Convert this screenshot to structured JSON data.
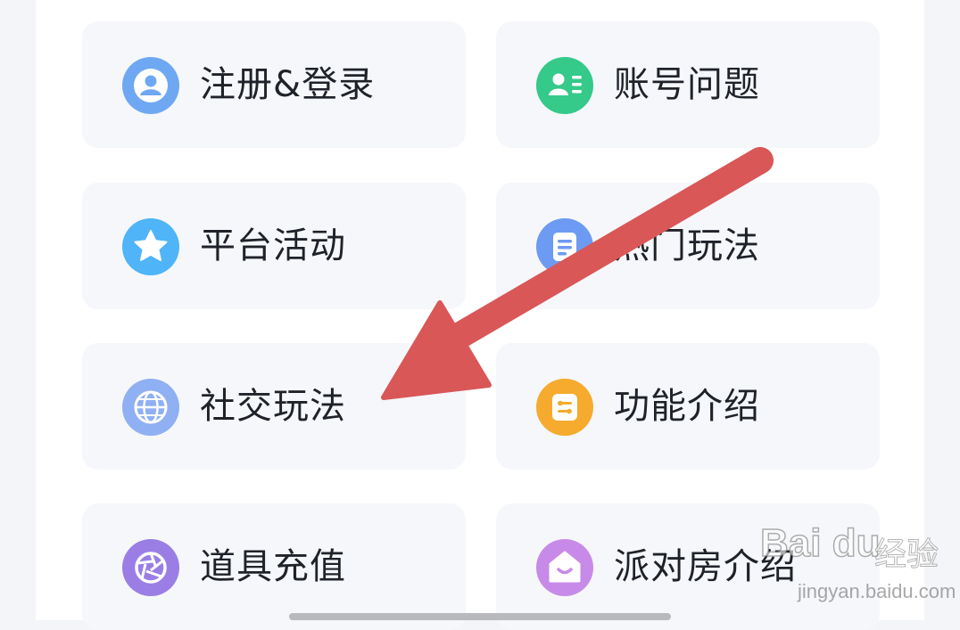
{
  "menu": {
    "items": [
      {
        "label": "注册&登录",
        "icon": "user-icon",
        "color": "#6ea8f2"
      },
      {
        "label": "账号问题",
        "icon": "contact-card-icon",
        "color": "#35c98a"
      },
      {
        "label": "平台活动",
        "icon": "star-icon",
        "color": "#4fb4f8"
      },
      {
        "label": "热门玩法",
        "icon": "document-icon",
        "color": "#6d9af2"
      },
      {
        "label": "社交玩法",
        "icon": "globe-icon",
        "color": "#8fb0f2"
      },
      {
        "label": "功能介绍",
        "icon": "sliders-icon",
        "color": "#f6ab2e"
      },
      {
        "label": "道具充值",
        "icon": "aperture-icon",
        "color": "#9a7ee6"
      },
      {
        "label": "派对房介绍",
        "icon": "home-icon",
        "color": "#c88ae8"
      }
    ]
  },
  "annotation": {
    "arrow_color": "#d95757"
  },
  "watermark": {
    "logo": "Bai du",
    "text": "经验",
    "url": "jingyan.baidu.com"
  }
}
